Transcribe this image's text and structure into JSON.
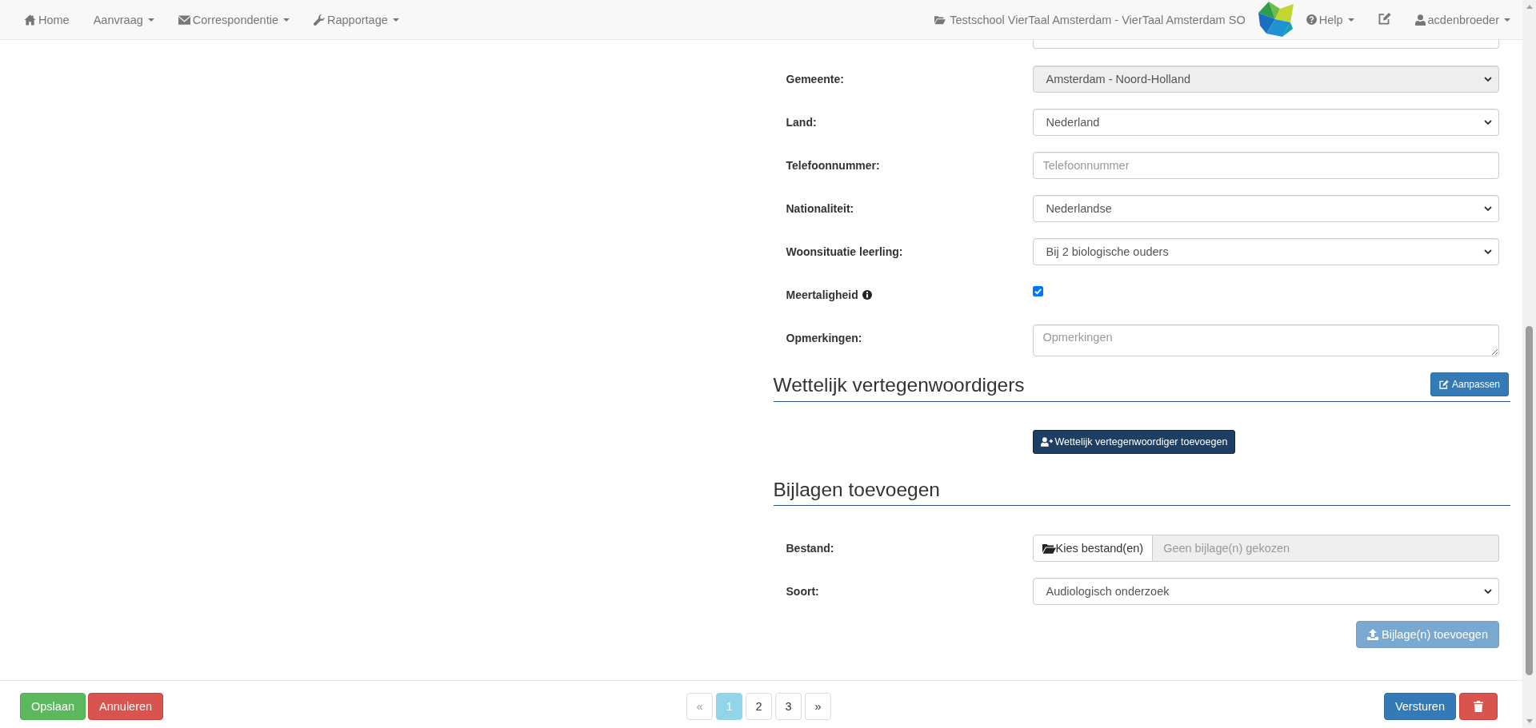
{
  "navbar": {
    "menu": [
      {
        "label": "Home",
        "dropdown": false
      },
      {
        "label": "Aanvraag",
        "dropdown": true
      },
      {
        "label": "Correspondentie",
        "dropdown": true
      },
      {
        "label": "Rapportage",
        "dropdown": true
      }
    ],
    "school": "Testschool VierTaal Amsterdam - VierTaal Amsterdam SO",
    "help": {
      "label": "Help",
      "dropdown": true
    },
    "user": {
      "label": "acdenbroeder",
      "dropdown": true
    }
  },
  "student_form": {
    "fields": [
      {
        "kind": "select",
        "label": "Gemeente:",
        "value": "Amsterdam - Noord-Holland",
        "disabled": true,
        "hint": false
      },
      {
        "kind": "select",
        "label": "Land:",
        "value": "Nederland",
        "disabled": false,
        "hint": false
      },
      {
        "kind": "input",
        "label": "Telefoonnummer:",
        "placeholder": "Telefoonnummer",
        "disabled": false,
        "hint": false
      },
      {
        "kind": "select",
        "label": "Nationaliteit:",
        "value": "Nederlandse",
        "disabled": false,
        "hint": false
      },
      {
        "kind": "select",
        "label": "Woonsituatie leerling:",
        "value": "Bij 2 biologische ouders",
        "disabled": false,
        "hint": false
      },
      {
        "kind": "checkbox",
        "label": "Meertaligheid",
        "checked": true,
        "disabled": false,
        "hint": true
      },
      {
        "kind": "textarea",
        "label": "Opmerkingen:",
        "placeholder": "Opmerkingen",
        "disabled": false,
        "hint": false
      }
    ]
  },
  "representatives": {
    "title": "Wettelijk vertegenwoordigers",
    "edit_button": "Aanpassen",
    "add_button": "Wettelijk vertegenwoordiger toevoegen"
  },
  "attachments": {
    "title": "Bijlagen toevoegen",
    "fields": [
      {
        "kind": "file",
        "label": "Bestand:",
        "button": "Kies bestand(en)",
        "placeholder": "Geen bijlage(n) gekozen",
        "disabled": false,
        "hint": false
      },
      {
        "kind": "select",
        "label": "Soort:",
        "value": "Audiologisch onderzoek",
        "disabled": false,
        "hint": false
      }
    ],
    "upload_button": {
      "label": "Bijlage(n) toevoegen",
      "disabled": true
    }
  },
  "footer": {
    "save_button": "Opslaan",
    "cancel_button": "Annuleren",
    "pagination": [
      {
        "label": "«",
        "selected": false,
        "disabled": true
      },
      {
        "label": "1",
        "selected": true,
        "disabled": false
      },
      {
        "label": "2",
        "selected": false,
        "disabled": false
      },
      {
        "label": "3",
        "selected": false,
        "disabled": false
      },
      {
        "label": "»",
        "selected": false,
        "disabled": false
      }
    ],
    "send_button": "Versturen"
  }
}
